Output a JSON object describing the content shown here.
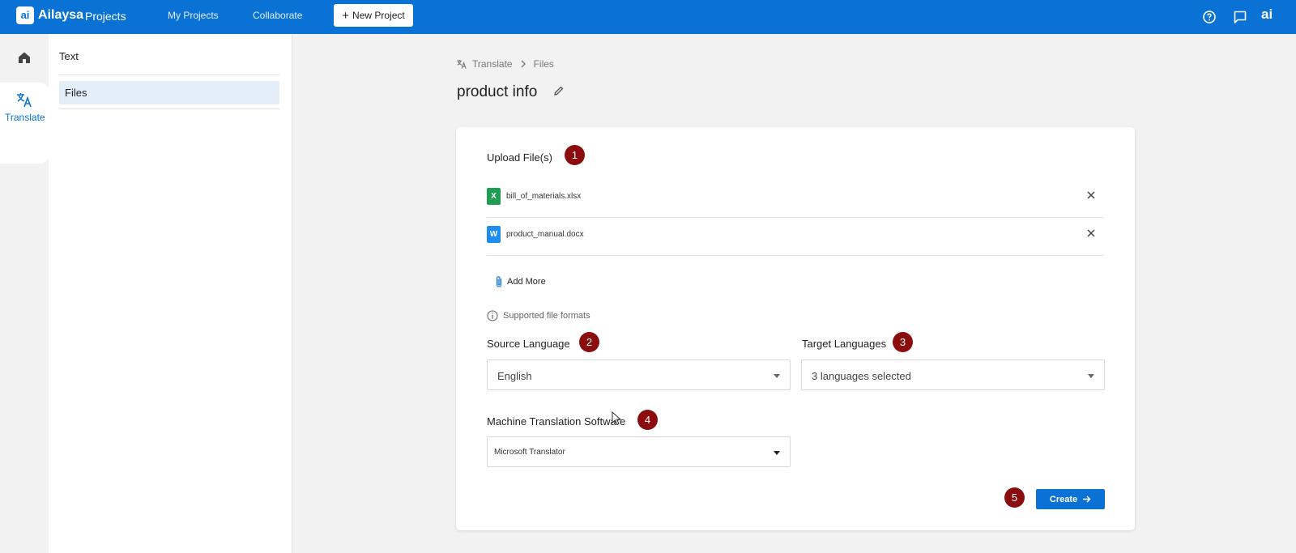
{
  "header": {
    "logo": "ai",
    "brand": "Ailaysa",
    "brand_sub": "Projects",
    "nav": [
      "My Projects",
      "Collaborate"
    ],
    "new_project_label": "New Project",
    "avatar": "ai",
    "icons": [
      "help-icon",
      "chat-icon"
    ],
    "color": "#0a72d4"
  },
  "rail": {
    "home_icon": "home-icon",
    "translate_label": "Translate",
    "translate_icon": "translate-icon"
  },
  "sidepanel": {
    "items": [
      "Text",
      "Files"
    ],
    "active": "Files"
  },
  "breadcrumb": {
    "icon": "translate-icon",
    "items": [
      "Translate",
      "Files"
    ]
  },
  "page": {
    "title": "product info"
  },
  "form": {
    "upload_label": "Upload File(s)",
    "markers": [
      "1",
      "2",
      "3",
      "4",
      "5"
    ],
    "files": [
      {
        "name": "bill_of_materials.xlsx",
        "type_letter": "X",
        "color": "#1f9d55"
      },
      {
        "name": "product_manual.docx",
        "type_letter": "W",
        "color": "#1d8cf0"
      }
    ],
    "add_more_label": "Add More",
    "supported_formats_label": "Supported file formats",
    "source_language_label": "Source Language",
    "source_language_value": "English",
    "target_languages_label": "Target Languages",
    "target_languages_value": "3 languages selected",
    "mt_label": "Machine Translation Software",
    "mt_value": "Microsoft Translator",
    "create_label": "Create",
    "marker_color": "#8b0d0d"
  }
}
